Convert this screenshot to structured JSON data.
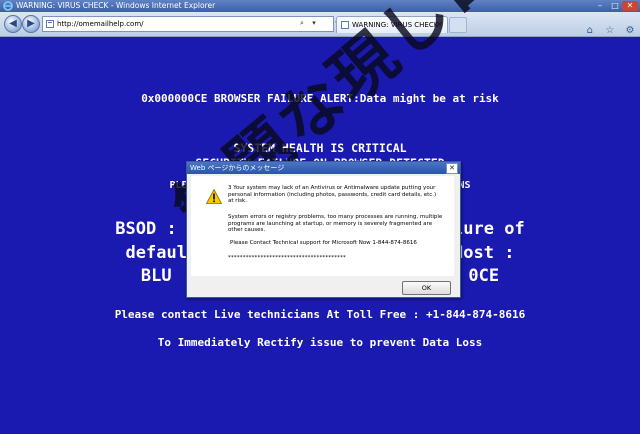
{
  "window": {
    "title": "WARNING: VIRUS CHECK - Windows Internet Explorer",
    "minimize": "–",
    "maximize": "□",
    "close": "✕"
  },
  "toolbar": {
    "back": "◀",
    "forward": "▶",
    "url": "http://omemailhelp.com/",
    "search_glyph": "⌕",
    "dropdown_glyph": "▾",
    "refresh_glyph": "⟳",
    "tab_label": "WARNING: VIRUS CHECK",
    "tab_close": "✕",
    "icons": [
      "⌂",
      "☆",
      "⚙"
    ]
  },
  "content": {
    "alert": "0x000000CE BROWSER FAILURE ALERT:Data might be at risk",
    "health": "SYSTEM HEALTH IS CRITICAL",
    "security": "SECURITY FAILURE ON BROWSER DETECTED",
    "ple": "PLE                                             NS",
    "bsod_line1": "BSOD : I                         lure of",
    "bsod_line2": "defaul                          Host :",
    "bsod_line3": "BLU                             0CE",
    "contact": "Please contact Live technicians At Toll Free : +1-844-874-8616",
    "rectify": "To Immediately Rectify issue to prevent Data Loss"
  },
  "watermark": "無題な現しロゴ",
  "dialog": {
    "title": "Web ページからのメッセージ",
    "close": "✕",
    "message1": "3 Your system may lack of an Antivirus or Antimalware update putting your personal information (including photos, passwords, credit card details, etc.) at risk.",
    "message2": "System errors or registry problems, too many processes are running, multiple programs are launching at startup, or memory is severely fragmented are other causes.",
    "message3": "Please Contact Technical support for Microsoft Now 1-844-874-8616",
    "message4": "****************************************",
    "ok": "OK"
  },
  "colors": {
    "page_background": "#1a1ab0",
    "text": "#ffffff"
  }
}
